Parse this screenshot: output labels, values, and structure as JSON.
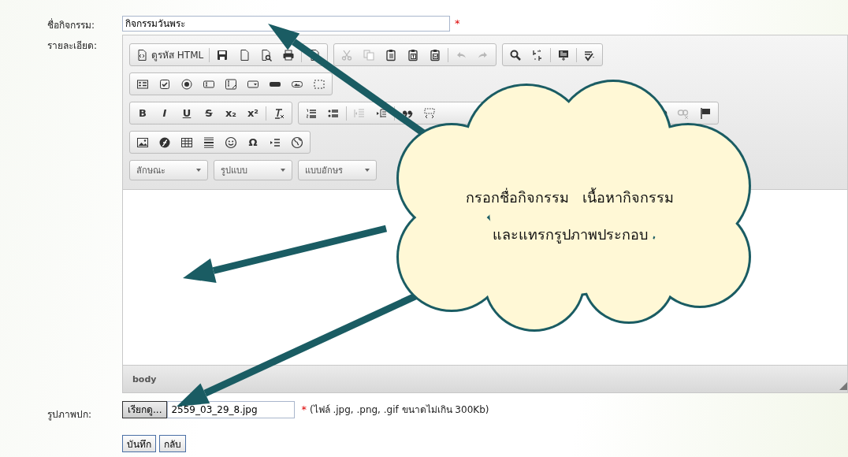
{
  "form": {
    "name_label": "ชื่อกิจกรรม:",
    "name_value": "กิจกรรมวันพระ",
    "name_required_mark": "*",
    "detail_label": "รายละเอียด:",
    "editor": {
      "toolbar_rows": [
        [
          [
            [
              {
                "label": "ดูรหัส HTML",
                "disabled": false
              }
            ],
            [
              {
                "disabled": false
              },
              {
                "disabled": false
              },
              {
                "disabled": false
              },
              {
                "disabled": false
              }
            ],
            [
              {
                "disabled": false
              }
            ]
          ],
          [
            [
              {
                "disabled": true
              },
              {
                "disabled": true
              },
              {
                "disabled": false
              },
              {
                "disabled": false
              },
              {
                "disabled": false
              }
            ],
            [
              {
                "disabled": true
              },
              {
                "disabled": true
              }
            ]
          ],
          [
            [
              {
                "disabled": false
              },
              {
                "disabled": false
              }
            ],
            [
              {
                "disabled": false
              }
            ],
            [
              {
                "disabled": false
              }
            ]
          ]
        ],
        [
          [
            [
              {
                "disabled": false
              },
              {
                "disabled": false
              },
              {
                "disabled": false
              },
              {
                "disabled": false
              },
              {
                "disabled": false
              },
              {
                "disabled": false
              },
              {
                "disabled": false
              },
              {
                "disabled": false
              },
              {
                "disabled": false
              }
            ]
          ]
        ],
        [
          [
            [
              {
                "glyph": "B",
                "disabled": false
              },
              {
                "glyph": "I",
                "disabled": false
              },
              {
                "glyph": "U",
                "disabled": false
              },
              {
                "glyph": "S",
                "disabled": false
              },
              {
                "glyph": "x₂",
                "disabled": false
              },
              {
                "glyph": "x²",
                "disabled": false
              }
            ],
            [
              {
                "disabled": false
              }
            ]
          ],
          [
            [
              {
                "disabled": false
              },
              {
                "disabled": false
              }
            ],
            [
              {
                "disabled": true
              },
              {
                "disabled": false
              }
            ],
            [
              {
                "disabled": false
              },
              {
                "disabled": false
              }
            ]
          ],
          [
            [
              {
                "disabled": false
              },
              {
                "disabled": true
              },
              {
                "disabled": false
              }
            ]
          ]
        ],
        [
          [
            [
              {
                "disabled": false
              },
              {
                "disabled": false
              },
              {
                "disabled": false
              },
              {
                "disabled": false
              },
              {
                "disabled": false
              },
              {
                "glyph": "Ω",
                "disabled": false
              },
              {
                "disabled": false
              },
              {
                "disabled": false
              }
            ]
          ]
        ]
      ],
      "combos": [
        "ลักษณะ",
        "รูปแบบ",
        "แบบอักษร"
      ],
      "status_path": "body"
    },
    "cover_label": "รูปภาพปก:",
    "browse_button": "เรียกดู...",
    "file_name": "2559_03_29_8.jpg",
    "file_required_mark": "*",
    "file_hint": "(ไฟล์ .jpg, .png, .gif ขนาดไม่เกิน 300Kb)",
    "buttons": [
      "บันทึก",
      "กลับ"
    ]
  },
  "callout": {
    "lines": [
      "กรอกชื่อกิจกรรม   เนื้อหากิจกรรม",
      "และแทรกรูปภาพประกอบ"
    ]
  }
}
